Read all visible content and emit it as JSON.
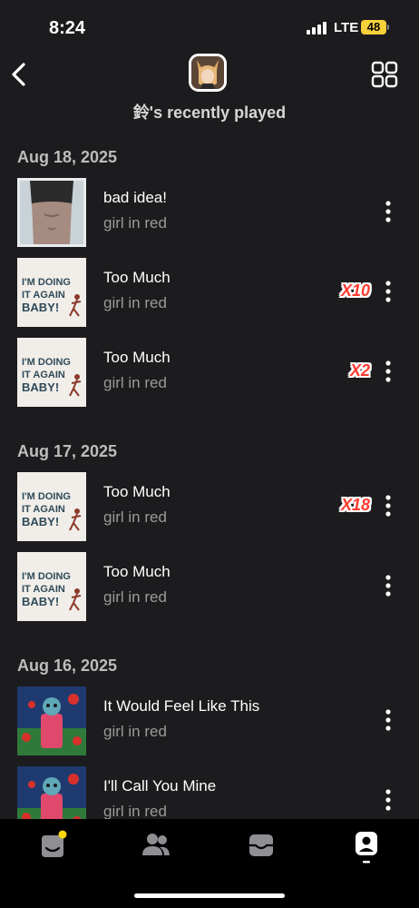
{
  "status_bar": {
    "time": "8:24",
    "network": "LTE",
    "battery": "48"
  },
  "header": {
    "title": "鈴's recently played",
    "back_icon": "chevron-left-icon",
    "grid_icon": "grid-icon"
  },
  "sections": [
    {
      "date": "Aug 18, 2025",
      "tracks": [
        {
          "title": "bad idea!",
          "artist": "girl in red",
          "count": "",
          "art": "bad-idea-cover"
        },
        {
          "title": "Too Much",
          "artist": "girl in red",
          "count": "X10",
          "art": "im-doing-it-again-baby-cover"
        },
        {
          "title": "Too Much",
          "artist": "girl in red",
          "count": "X2",
          "art": "im-doing-it-again-baby-cover"
        }
      ]
    },
    {
      "date": "Aug 17, 2025",
      "tracks": [
        {
          "title": "Too Much",
          "artist": "girl in red",
          "count": "X18",
          "art": "im-doing-it-again-baby-cover"
        },
        {
          "title": "Too Much",
          "artist": "girl in red",
          "count": "",
          "art": "im-doing-it-again-baby-cover"
        }
      ]
    },
    {
      "date": "Aug 16, 2025",
      "tracks": [
        {
          "title": "It Would Feel Like This",
          "artist": "girl in red",
          "count": "",
          "art": "painting-cover"
        },
        {
          "title": "I'll Call You Mine",
          "artist": "girl in red",
          "count": "",
          "art": "painting-cover"
        }
      ]
    }
  ],
  "album_art_text": {
    "line1": "I'M DOING",
    "line2": "IT AGAIN",
    "line3": "BABY!"
  },
  "tab_bar": [
    {
      "name": "home-tab",
      "icon": "home-icon",
      "badge": true
    },
    {
      "name": "friends-tab",
      "icon": "friends-icon",
      "badge": false
    },
    {
      "name": "inbox-tab",
      "icon": "inbox-icon",
      "badge": false
    },
    {
      "name": "profile-tab",
      "icon": "profile-icon",
      "badge": false,
      "active": true
    }
  ],
  "colors": {
    "background": "#1c1c1e",
    "count_badge": "#ff3b30",
    "badge_dot": "#ffd60a",
    "battery": "#f7d13a"
  }
}
